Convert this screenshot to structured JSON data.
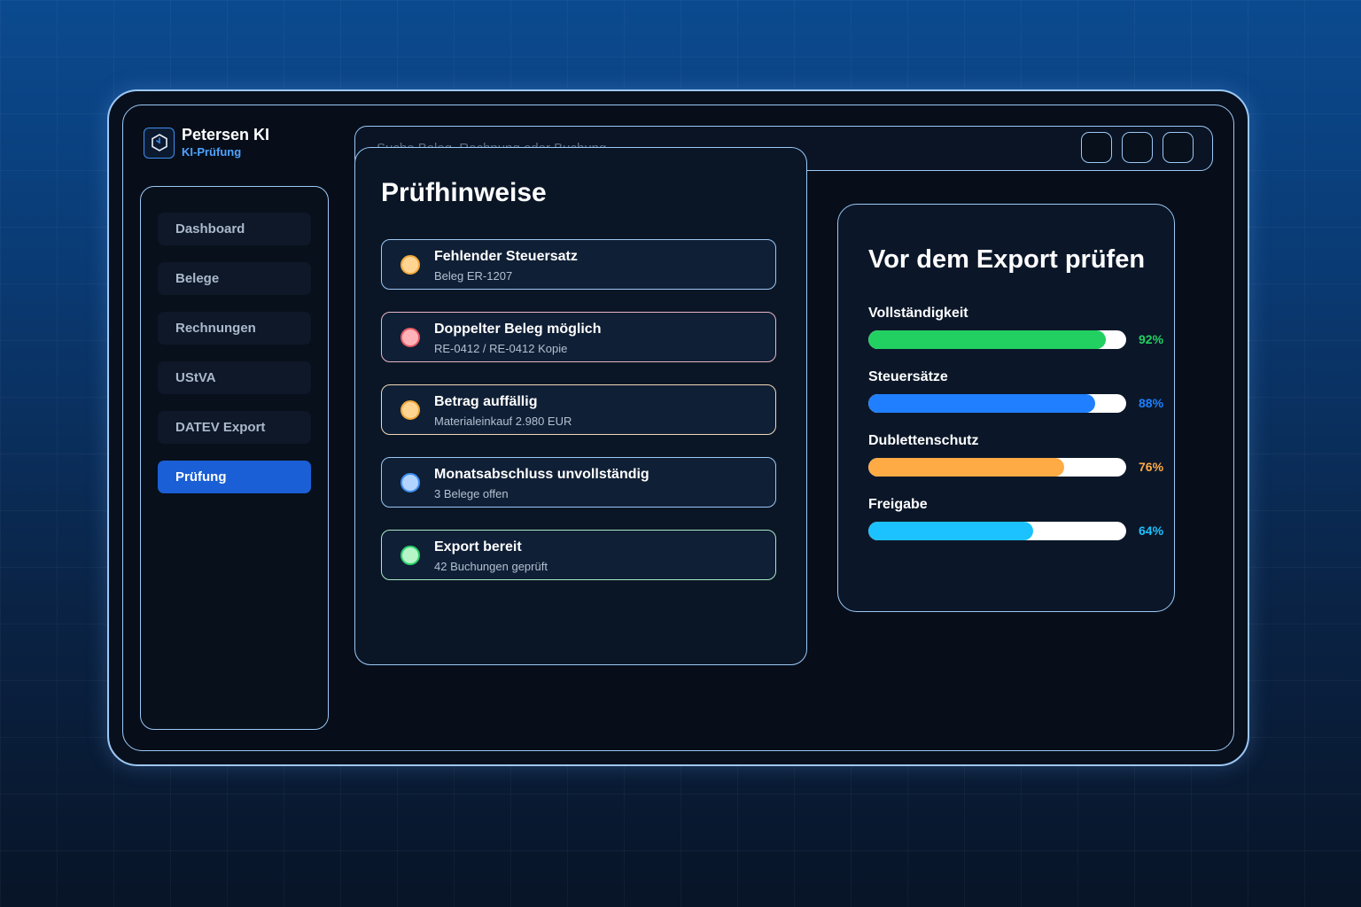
{
  "brand": {
    "name": "Petersen KI",
    "subtitle": "KI-Prüfung",
    "logo_icon": "hexagon-logo-icon"
  },
  "search": {
    "placeholder": "Suche Beleg, Rechnung oder Buchung"
  },
  "sidebar": {
    "items": [
      {
        "label": "Dashboard",
        "active": false
      },
      {
        "label": "Belege",
        "active": false
      },
      {
        "label": "Rechnungen",
        "active": false
      },
      {
        "label": "UStVA",
        "active": false
      },
      {
        "label": "DATEV Export",
        "active": false
      },
      {
        "label": "Prüfung",
        "active": true
      }
    ]
  },
  "hints": {
    "title": "Prüfhinweise",
    "items": [
      {
        "title": "Fehlender Steuersatz",
        "subtitle": "Beleg ER-1207",
        "dot_color": "#ffd591",
        "dot_border": "#f2a93b",
        "border": "#9cc8f5"
      },
      {
        "title": "Doppelter Beleg möglich",
        "subtitle": "RE-0412 / RE-0412 Kopie",
        "dot_color": "#ffb3b8",
        "dot_border": "#e85b66",
        "border": "#e7b6c4"
      },
      {
        "title": "Betrag auffällig",
        "subtitle": "Materialeinkauf 2.980 EUR",
        "dot_color": "#ffd591",
        "dot_border": "#f2a93b",
        "border": "#f0d9b8"
      },
      {
        "title": "Monatsabschluss unvollständig",
        "subtitle": "3 Belege offen",
        "dot_color": "#b3d4ff",
        "dot_border": "#3d8ff0",
        "border": "#9cc8f5"
      },
      {
        "title": "Export bereit",
        "subtitle": "42 Buchungen geprüft",
        "dot_color": "#b5f5c8",
        "dot_border": "#2ccf6a",
        "border": "#a8e8c4"
      }
    ]
  },
  "export_check": {
    "title": "Vor dem Export prüfen",
    "metrics": [
      {
        "label": "Vollständigkeit",
        "value": 92,
        "value_text": "92%",
        "color": "#22d061"
      },
      {
        "label": "Steuersätze",
        "value": 88,
        "value_text": "88%",
        "color": "#1f7fff"
      },
      {
        "label": "Dublettenschutz",
        "value": 76,
        "value_text": "76%",
        "color": "#ffab45"
      },
      {
        "label": "Freigabe",
        "value": 64,
        "value_text": "64%",
        "color": "#1cc2ff"
      }
    ]
  }
}
